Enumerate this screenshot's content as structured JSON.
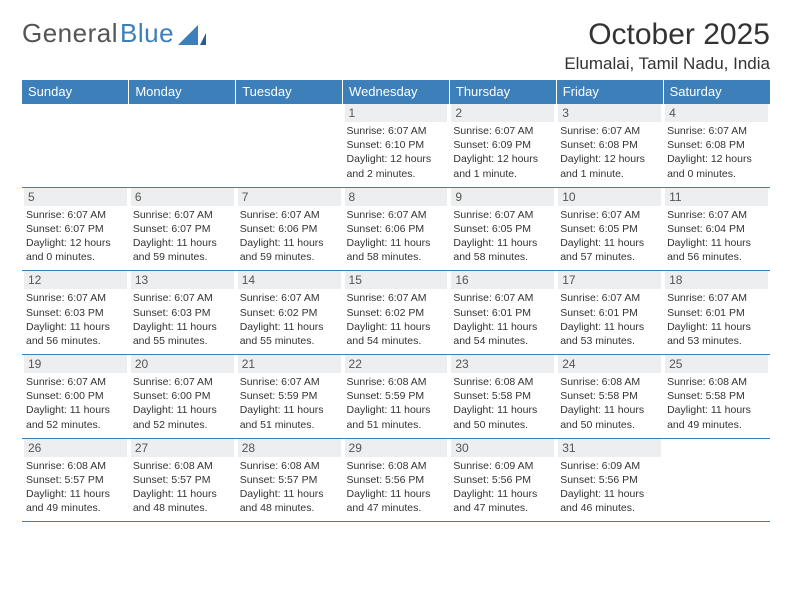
{
  "logo": {
    "part1": "General",
    "part2": "Blue"
  },
  "header": {
    "month": "October 2025",
    "location": "Elumalai, Tamil Nadu, India"
  },
  "weekdays": [
    "Sunday",
    "Monday",
    "Tuesday",
    "Wednesday",
    "Thursday",
    "Friday",
    "Saturday"
  ],
  "days": [
    {
      "n": "",
      "sunrise": "",
      "sunset": "",
      "daylight": ""
    },
    {
      "n": "",
      "sunrise": "",
      "sunset": "",
      "daylight": ""
    },
    {
      "n": "",
      "sunrise": "",
      "sunset": "",
      "daylight": ""
    },
    {
      "n": "1",
      "sunrise": "6:07 AM",
      "sunset": "6:10 PM",
      "daylight": "12 hours and 2 minutes."
    },
    {
      "n": "2",
      "sunrise": "6:07 AM",
      "sunset": "6:09 PM",
      "daylight": "12 hours and 1 minute."
    },
    {
      "n": "3",
      "sunrise": "6:07 AM",
      "sunset": "6:08 PM",
      "daylight": "12 hours and 1 minute."
    },
    {
      "n": "4",
      "sunrise": "6:07 AM",
      "sunset": "6:08 PM",
      "daylight": "12 hours and 0 minutes."
    },
    {
      "n": "5",
      "sunrise": "6:07 AM",
      "sunset": "6:07 PM",
      "daylight": "12 hours and 0 minutes."
    },
    {
      "n": "6",
      "sunrise": "6:07 AM",
      "sunset": "6:07 PM",
      "daylight": "11 hours and 59 minutes."
    },
    {
      "n": "7",
      "sunrise": "6:07 AM",
      "sunset": "6:06 PM",
      "daylight": "11 hours and 59 minutes."
    },
    {
      "n": "8",
      "sunrise": "6:07 AM",
      "sunset": "6:06 PM",
      "daylight": "11 hours and 58 minutes."
    },
    {
      "n": "9",
      "sunrise": "6:07 AM",
      "sunset": "6:05 PM",
      "daylight": "11 hours and 58 minutes."
    },
    {
      "n": "10",
      "sunrise": "6:07 AM",
      "sunset": "6:05 PM",
      "daylight": "11 hours and 57 minutes."
    },
    {
      "n": "11",
      "sunrise": "6:07 AM",
      "sunset": "6:04 PM",
      "daylight": "11 hours and 56 minutes."
    },
    {
      "n": "12",
      "sunrise": "6:07 AM",
      "sunset": "6:03 PM",
      "daylight": "11 hours and 56 minutes."
    },
    {
      "n": "13",
      "sunrise": "6:07 AM",
      "sunset": "6:03 PM",
      "daylight": "11 hours and 55 minutes."
    },
    {
      "n": "14",
      "sunrise": "6:07 AM",
      "sunset": "6:02 PM",
      "daylight": "11 hours and 55 minutes."
    },
    {
      "n": "15",
      "sunrise": "6:07 AM",
      "sunset": "6:02 PM",
      "daylight": "11 hours and 54 minutes."
    },
    {
      "n": "16",
      "sunrise": "6:07 AM",
      "sunset": "6:01 PM",
      "daylight": "11 hours and 54 minutes."
    },
    {
      "n": "17",
      "sunrise": "6:07 AM",
      "sunset": "6:01 PM",
      "daylight": "11 hours and 53 minutes."
    },
    {
      "n": "18",
      "sunrise": "6:07 AM",
      "sunset": "6:01 PM",
      "daylight": "11 hours and 53 minutes."
    },
    {
      "n": "19",
      "sunrise": "6:07 AM",
      "sunset": "6:00 PM",
      "daylight": "11 hours and 52 minutes."
    },
    {
      "n": "20",
      "sunrise": "6:07 AM",
      "sunset": "6:00 PM",
      "daylight": "11 hours and 52 minutes."
    },
    {
      "n": "21",
      "sunrise": "6:07 AM",
      "sunset": "5:59 PM",
      "daylight": "11 hours and 51 minutes."
    },
    {
      "n": "22",
      "sunrise": "6:08 AM",
      "sunset": "5:59 PM",
      "daylight": "11 hours and 51 minutes."
    },
    {
      "n": "23",
      "sunrise": "6:08 AM",
      "sunset": "5:58 PM",
      "daylight": "11 hours and 50 minutes."
    },
    {
      "n": "24",
      "sunrise": "6:08 AM",
      "sunset": "5:58 PM",
      "daylight": "11 hours and 50 minutes."
    },
    {
      "n": "25",
      "sunrise": "6:08 AM",
      "sunset": "5:58 PM",
      "daylight": "11 hours and 49 minutes."
    },
    {
      "n": "26",
      "sunrise": "6:08 AM",
      "sunset": "5:57 PM",
      "daylight": "11 hours and 49 minutes."
    },
    {
      "n": "27",
      "sunrise": "6:08 AM",
      "sunset": "5:57 PM",
      "daylight": "11 hours and 48 minutes."
    },
    {
      "n": "28",
      "sunrise": "6:08 AM",
      "sunset": "5:57 PM",
      "daylight": "11 hours and 48 minutes."
    },
    {
      "n": "29",
      "sunrise": "6:08 AM",
      "sunset": "5:56 PM",
      "daylight": "11 hours and 47 minutes."
    },
    {
      "n": "30",
      "sunrise": "6:09 AM",
      "sunset": "5:56 PM",
      "daylight": "11 hours and 47 minutes."
    },
    {
      "n": "31",
      "sunrise": "6:09 AM",
      "sunset": "5:56 PM",
      "daylight": "11 hours and 46 minutes."
    },
    {
      "n": "",
      "sunrise": "",
      "sunset": "",
      "daylight": ""
    }
  ],
  "labels": {
    "sunrise": "Sunrise:",
    "sunset": "Sunset:",
    "daylight": "Daylight:"
  }
}
